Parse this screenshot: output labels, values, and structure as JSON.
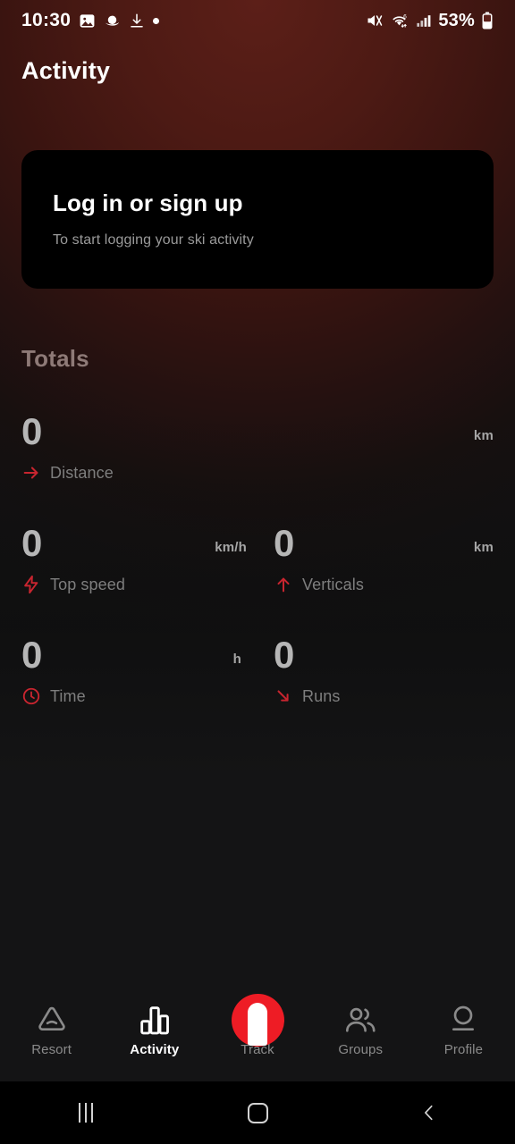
{
  "status_bar": {
    "time": "10:30",
    "battery_percent": "53%",
    "left_icons": [
      "photo-icon",
      "planet-icon",
      "download-icon",
      "dot-icon"
    ],
    "right_icons": [
      "mute-icon",
      "wifi-6-icon",
      "signal-icon",
      "battery-icon"
    ]
  },
  "header": {
    "title": "Activity"
  },
  "login_card": {
    "title": "Log in or sign up",
    "subtitle": "To start logging your ski activity"
  },
  "totals": {
    "heading": "Totals",
    "rows": [
      [
        {
          "value": "0",
          "unit": "km",
          "label": "Distance",
          "icon": "arrow-right-icon"
        }
      ],
      [
        {
          "value": "0",
          "unit": "km/h",
          "label": "Top speed",
          "icon": "zap-icon"
        },
        {
          "value": "0",
          "unit": "km",
          "label": "Verticals",
          "icon": "arrow-up-icon"
        }
      ],
      [
        {
          "value": "0",
          "unit": "h",
          "label": "Time",
          "icon": "clock-icon"
        },
        {
          "value": "0",
          "unit": "",
          "label": "Runs",
          "icon": "arrow-down-right-icon"
        }
      ]
    ]
  },
  "bottom_nav": {
    "items": [
      {
        "label": "Resort",
        "icon": "mountain-icon",
        "active": false
      },
      {
        "label": "Activity",
        "icon": "bar-chart-icon",
        "active": true
      },
      {
        "label": "Track",
        "icon": "track-ski-icon",
        "active": false
      },
      {
        "label": "Groups",
        "icon": "people-icon",
        "active": false
      },
      {
        "label": "Profile",
        "icon": "person-icon",
        "active": false
      }
    ]
  },
  "android_nav": {
    "recents": "recents-icon",
    "home": "home-icon",
    "back": "back-icon"
  },
  "colors": {
    "accent_red": "#ee1c25",
    "icon_red": "#c8252f",
    "background_top": "#5c1f18",
    "background_bottom": "#141415",
    "card_bg": "#000000"
  }
}
